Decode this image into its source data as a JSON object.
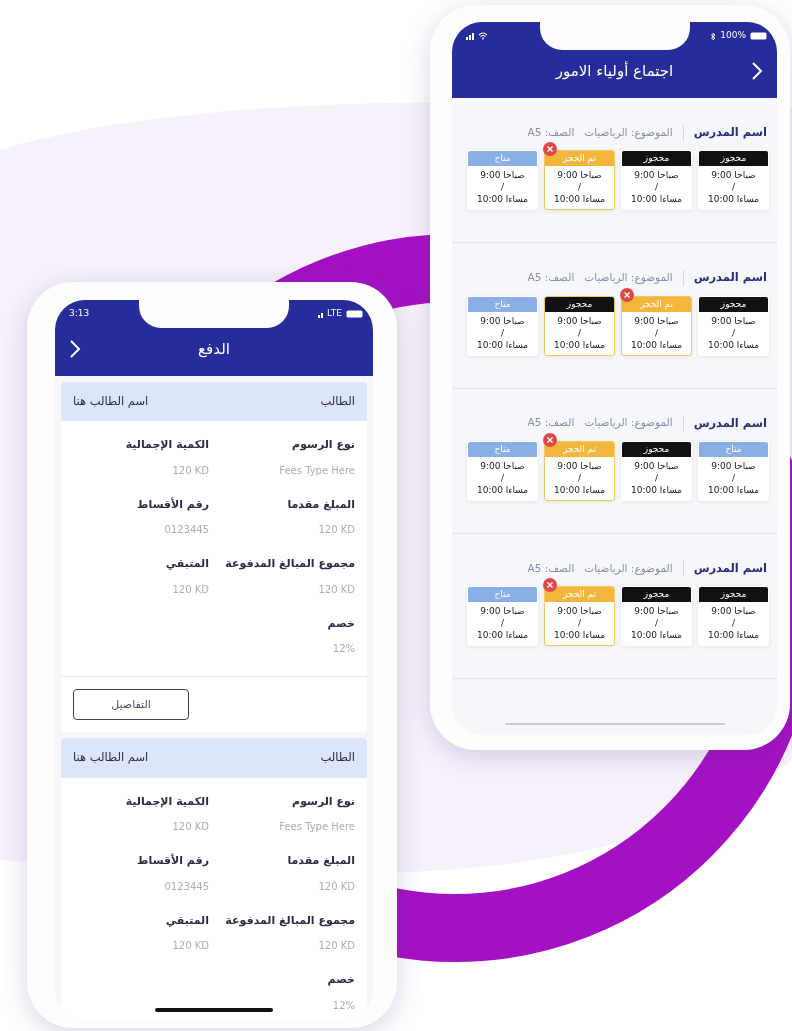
{
  "phones": [
    {
      "kind": "meetings",
      "status_bar": {
        "battery": "100%"
      },
      "title": "اجتماع أولياء الامور",
      "sections": [
        {
          "teacher": "اسم المدرس",
          "subject": "الموضوع: الرياضيات",
          "class": "الصف: A5",
          "slots": [
            {
              "kind": "booked",
              "status": "محجوز",
              "start": "صباحا 9:00",
              "separator": "/",
              "end": "مساءا 10:00",
              "outlined": false
            },
            {
              "kind": "booked",
              "status": "محجوز",
              "start": "صباحا 9:00",
              "separator": "/",
              "end": "مساءا 10:00",
              "outlined": false
            },
            {
              "kind": "reserved",
              "status": "تم الحجز",
              "start": "صباحا 9:00",
              "separator": "/",
              "end": "مساءا 10:00",
              "outlined": true
            },
            {
              "kind": "available",
              "status": "متاح",
              "start": "صباحا 9:00",
              "separator": "/",
              "end": "مساءا 10:00",
              "outlined": false
            }
          ]
        },
        {
          "teacher": "اسم المدرس",
          "subject": "الموضوع: الرياضيات",
          "class": "الصف: A5",
          "slots": [
            {
              "kind": "booked",
              "status": "محجوز",
              "start": "صباحا 9:00",
              "separator": "/",
              "end": "مساءا 10:00",
              "outlined": false
            },
            {
              "kind": "reserved",
              "status": "تم الحجز",
              "start": "صباحا 9:00",
              "separator": "/",
              "end": "مساءا 10:00",
              "outlined": true
            },
            {
              "kind": "booked",
              "status": "محجوز",
              "start": "صباحا 9:00",
              "separator": "/",
              "end": "مساءا 10:00",
              "outlined": true
            },
            {
              "kind": "available",
              "status": "متاح",
              "start": "صباحا 9:00",
              "separator": "/",
              "end": "مساءا 10:00",
              "outlined": false
            }
          ]
        },
        {
          "teacher": "اسم المدرس",
          "subject": "الموضوع: الرياضيات",
          "class": "الصف: A5",
          "slots": [
            {
              "kind": "available",
              "status": "متاح",
              "start": "صباحا 9:00",
              "separator": "/",
              "end": "مساءا 10:00",
              "outlined": false
            },
            {
              "kind": "booked",
              "status": "محجوز",
              "start": "صباحا 9:00",
              "separator": "/",
              "end": "مساءا 10:00",
              "outlined": false
            },
            {
              "kind": "reserved",
              "status": "تم الحجز",
              "start": "صباحا 9:00",
              "separator": "/",
              "end": "مساءا 10:00",
              "outlined": true
            },
            {
              "kind": "available",
              "status": "متاح",
              "start": "صباحا 9:00",
              "separator": "/",
              "end": "مساءا 10:00",
              "outlined": false
            }
          ]
        },
        {
          "teacher": "اسم المدرس",
          "subject": "الموضوع: الرياضيات",
          "class": "الصف: A5",
          "slots": [
            {
              "kind": "booked",
              "status": "محجوز",
              "start": "صباحا 9:00",
              "separator": "/",
              "end": "مساءا 10:00",
              "outlined": false
            },
            {
              "kind": "booked",
              "status": "محجوز",
              "start": "صباحا 9:00",
              "separator": "/",
              "end": "مساءا 10:00",
              "outlined": false
            },
            {
              "kind": "reserved",
              "status": "تم الحجز",
              "start": "صباحا 9:00",
              "separator": "/",
              "end": "مساءا 10:00",
              "outlined": true
            },
            {
              "kind": "available",
              "status": "متاح",
              "start": "صباحا 9:00",
              "separator": "/",
              "end": "مساءا 10:00",
              "outlined": false
            }
          ]
        }
      ]
    },
    {
      "kind": "payment",
      "status_bar": {
        "time": "3:13",
        "network": "LTE"
      },
      "title": "الدفع",
      "cards": [
        {
          "header_label": "الطالب",
          "header_value": "اسم الطالب هنا",
          "fields": [
            {
              "label": "نوع الرسوم",
              "value": "Fees Type Here"
            },
            {
              "label": "الكمية الإجمالية",
              "value": "120 KD"
            },
            {
              "label": "المبلغ مقدما",
              "value": "120 KD"
            },
            {
              "label": "رقم الأقساط",
              "value": "0123445"
            },
            {
              "label": "مجموع المبالغ المدفوعة",
              "value": "120 KD"
            },
            {
              "label": "المتبقي",
              "value": "120 KD"
            },
            {
              "label": "خصم",
              "value": "12%"
            }
          ],
          "button": "التفاصيل"
        },
        {
          "header_label": "الطالب",
          "header_value": "اسم الطالب هنا",
          "fields": [
            {
              "label": "نوع الرسوم",
              "value": "Fees Type Here"
            },
            {
              "label": "الكمية الإجمالية",
              "value": "120 KD"
            },
            {
              "label": "المبلغ مقدما",
              "value": "120 KD"
            },
            {
              "label": "رقم الأقساط",
              "value": "0123445"
            },
            {
              "label": "مجموع المبالغ المدفوعة",
              "value": "120 KD"
            },
            {
              "label": "المتبقي",
              "value": "120 KD"
            },
            {
              "label": "خصم",
              "value": "12%"
            }
          ]
        }
      ]
    }
  ]
}
